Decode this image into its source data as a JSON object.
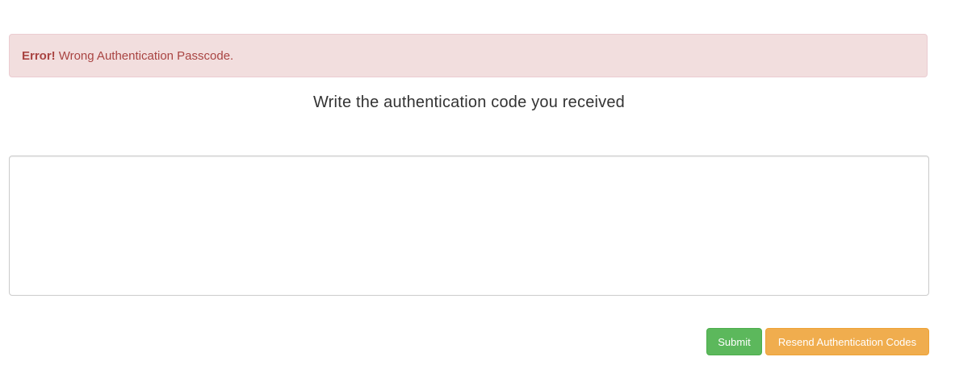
{
  "alert": {
    "label": "Error!",
    "message": "Wrong Authentication Passcode."
  },
  "form": {
    "heading": "Write the authentication code you received",
    "code_value": "",
    "submit_label": "Submit",
    "resend_label": "Resend Authentication Codes"
  },
  "colors": {
    "alert_bg": "#f2dede",
    "alert_text": "#a94442",
    "submit_bg": "#5cb85c",
    "resend_bg": "#f0ad4e"
  }
}
